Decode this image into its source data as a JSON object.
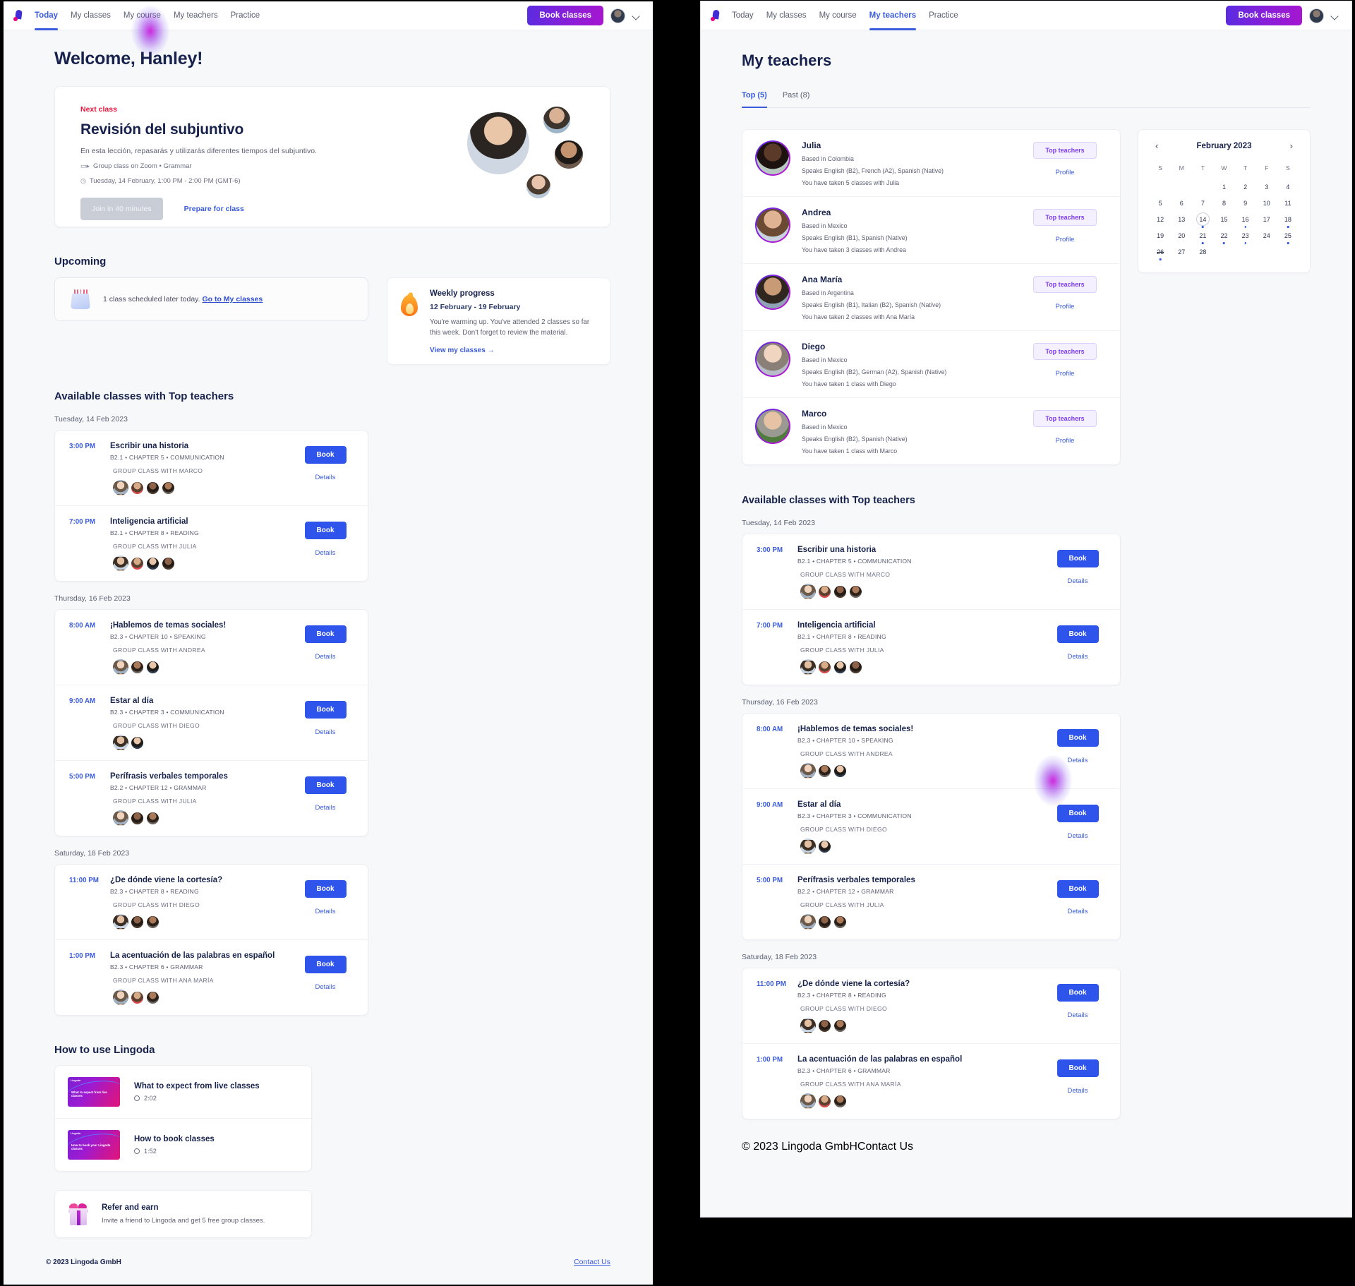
{
  "nav": {
    "logo": "lingoda-logo",
    "links": [
      "Today",
      "My classes",
      "My course",
      "My teachers",
      "Practice"
    ],
    "left_active": "Today",
    "right_active": "My teachers",
    "book_classes": "Book classes",
    "avatar": "user-avatar",
    "chevron": "chevron-down-icon"
  },
  "left": {
    "greeting": "Welcome, Hanley!",
    "next_class": {
      "label": "Next class",
      "title": "Revisión del subjuntivo",
      "description": "En esta lección, repasarás y utilizarás diferentes tiempos del subjuntivo.",
      "meta_type": "Group class on Zoom  •  Grammar",
      "meta_time": "Tuesday, 14 February, 1:00 PM - 2:00 PM (GMT-6)",
      "join_button": "Join in 40 minutes",
      "prepare_link": "Prepare for class"
    },
    "upcoming": {
      "heading": "Upcoming",
      "text": "1 class scheduled later today.",
      "link": "Go to My classes"
    },
    "weekly_progress": {
      "title": "Weekly progress",
      "range": "12 February - 19 February",
      "body": "You're warming up. You've attended 2 classes so far this week. Don't forget to review the material.",
      "link": "View my classes"
    },
    "available_heading": "Available classes with Top teachers",
    "groups": [
      {
        "date": "Tuesday, 14 Feb 2023",
        "classes": [
          {
            "time": "3:00 PM",
            "title": "Escribir una historia",
            "sub": "B2.1 • CHAPTER 5 • COMMUNICATION",
            "with": "GROUP CLASS WITH MARCO",
            "book": "Book",
            "details": "Details"
          },
          {
            "time": "7:00 PM",
            "title": "Inteligencia artificial",
            "sub": "B2.1 • CHAPTER 8 • READING",
            "with": "GROUP CLASS WITH JULIA",
            "book": "Book",
            "details": "Details"
          }
        ]
      },
      {
        "date": "Thursday, 16 Feb 2023",
        "classes": [
          {
            "time": "8:00 AM",
            "title": "¡Hablemos de temas sociales!",
            "sub": "B2.3 • CHAPTER 10 • SPEAKING",
            "with": "GROUP CLASS WITH ANDREA",
            "book": "Book",
            "details": "Details"
          },
          {
            "time": "9:00 AM",
            "title": "Estar al día",
            "sub": "B2.3 • CHAPTER 3 • COMMUNICATION",
            "with": "GROUP CLASS WITH DIEGO",
            "book": "Book",
            "details": "Details"
          },
          {
            "time": "5:00 PM",
            "title": "Perífrasis verbales temporales",
            "sub": "B2.2 • CHAPTER 12 • GRAMMAR",
            "with": "GROUP CLASS WITH JULIA",
            "book": "Book",
            "details": "Details"
          }
        ]
      },
      {
        "date": "Saturday, 18 Feb 2023",
        "classes": [
          {
            "time": "11:00 PM",
            "title": "¿De dónde viene la cortesía?",
            "sub": "B2.3 • CHAPTER 8 • READING",
            "with": "GROUP CLASS WITH DIEGO",
            "book": "Book",
            "details": "Details"
          },
          {
            "time": "1:00 PM",
            "title": "La acentuación de las palabras en español",
            "sub": "B2.3 • CHAPTER 6 • GRAMMAR",
            "with": "GROUP CLASS WITH ANA MARÍA",
            "book": "Book",
            "details": "Details"
          }
        ]
      }
    ],
    "howto": {
      "heading": "How to use Lingoda",
      "videos": [
        {
          "title": "What to expect from live classes",
          "duration": "2:02",
          "thumb_caption": "What to expect from live classes",
          "thumb_brand": "Lingoda"
        },
        {
          "title": "How to book classes",
          "duration": "1:52",
          "thumb_caption": "How to book your Lingoda classes",
          "thumb_brand": "Lingoda"
        }
      ]
    },
    "refer": {
      "title": "Refer and earn",
      "subtitle": "Invite a friend to Lingoda and get 5 free group classes."
    },
    "footer": {
      "copyright": "© 2023 Lingoda GmbH",
      "contact": "Contact Us"
    }
  },
  "right": {
    "title": "My teachers",
    "tabs": [
      {
        "label": "Top (5)",
        "active": true
      },
      {
        "label": "Past (8)",
        "active": false
      }
    ],
    "teachers": [
      {
        "name": "Julia",
        "based": "Based in Colombia",
        "speaks": "Speaks English (B2), French (A2), Spanish (Native)",
        "classes": "You have taken 5 classes with Julia",
        "badge": "Top teachers",
        "profile": "Profile"
      },
      {
        "name": "Andrea",
        "based": "Based in Mexico",
        "speaks": "Speaks English (B1), Spanish (Native)",
        "classes": "You have taken 3 classes with Andrea",
        "badge": "Top teachers",
        "profile": "Profile"
      },
      {
        "name": "Ana María",
        "based": "Based in Argentina",
        "speaks": "Speaks English (B1), Italian (B2), Spanish (Native)",
        "classes": "You have taken 2 classes with Ana María",
        "badge": "Top teachers",
        "profile": "Profile"
      },
      {
        "name": "Diego",
        "based": "Based in Mexico",
        "speaks": "Speaks English (B2), German (A2), Spanish (Native)",
        "classes": "You have taken 1 class with Diego",
        "badge": "Top teachers",
        "profile": "Profile"
      },
      {
        "name": "Marco",
        "based": "Based in Mexico",
        "speaks": "Speaks English (B2), Spanish (Native)",
        "classes": "You have taken 1 class with Marco",
        "badge": "Top teachers",
        "profile": "Profile"
      }
    ],
    "calendar": {
      "title": "February 2023",
      "prev": "‹",
      "next": "›",
      "dow": [
        "S",
        "M",
        "T",
        "W",
        "T",
        "F",
        "S"
      ],
      "lead_blanks": 3,
      "days": 28,
      "today": 14,
      "struck": [
        26
      ],
      "dots": [
        14,
        16,
        18,
        21,
        22,
        23,
        25,
        26
      ]
    },
    "available_heading": "Available classes with Top teachers",
    "groups": [
      {
        "date": "Tuesday, 14 Feb 2023",
        "classes": [
          {
            "time": "3:00 PM",
            "title": "Escribir una historia",
            "sub": "B2.1 • CHAPTER 5 • COMMUNICATION",
            "with": "GROUP CLASS WITH MARCO",
            "book": "Book",
            "details": "Details"
          },
          {
            "time": "7:00 PM",
            "title": "Inteligencia artificial",
            "sub": "B2.1 • CHAPTER 8 • READING",
            "with": "GROUP CLASS WITH JULIA",
            "book": "Book",
            "details": "Details"
          }
        ]
      },
      {
        "date": "Thursday, 16 Feb 2023",
        "classes": [
          {
            "time": "8:00 AM",
            "title": "¡Hablemos de temas sociales!",
            "sub": "B2.3 • CHAPTER 10 • SPEAKING",
            "with": "GROUP CLASS WITH ANDREA",
            "book": "Book",
            "details": "Details"
          },
          {
            "time": "9:00 AM",
            "title": "Estar al día",
            "sub": "B2.3 • CHAPTER 3 • COMMUNICATION",
            "with": "GROUP CLASS WITH DIEGO",
            "book": "Book",
            "details": "Details"
          },
          {
            "time": "5:00 PM",
            "title": "Perífrasis verbales temporales",
            "sub": "B2.2 • CHAPTER 12 • GRAMMAR",
            "with": "GROUP CLASS WITH JULIA",
            "book": "Book",
            "details": "Details"
          }
        ]
      },
      {
        "date": "Saturday, 18 Feb 2023",
        "classes": [
          {
            "time": "11:00 PM",
            "title": "¿De dónde viene la cortesía?",
            "sub": "B2.3 • CHAPTER 8 • READING",
            "with": "GROUP CLASS WITH DIEGO",
            "book": "Book",
            "details": "Details"
          },
          {
            "time": "1:00 PM",
            "title": "La acentuación de las palabras en español",
            "sub": "B2.3 • CHAPTER 6 • GRAMMAR",
            "with": "GROUP CLASS WITH ANA MARÍA",
            "book": "Book",
            "details": "Details"
          }
        ]
      }
    ],
    "footer": {
      "copyright": "© 2023 Lingoda GmbH",
      "contact": "Contact Us"
    }
  },
  "colors": {
    "accent_blue": "#3a5bdb",
    "book_blue": "#2f54eb",
    "brand_purple": "#5b2be0",
    "brand_magenta": "#e6007e",
    "red_label": "#e8153b",
    "heading_navy": "#17224d",
    "page_bg": "#f7f8fa"
  }
}
